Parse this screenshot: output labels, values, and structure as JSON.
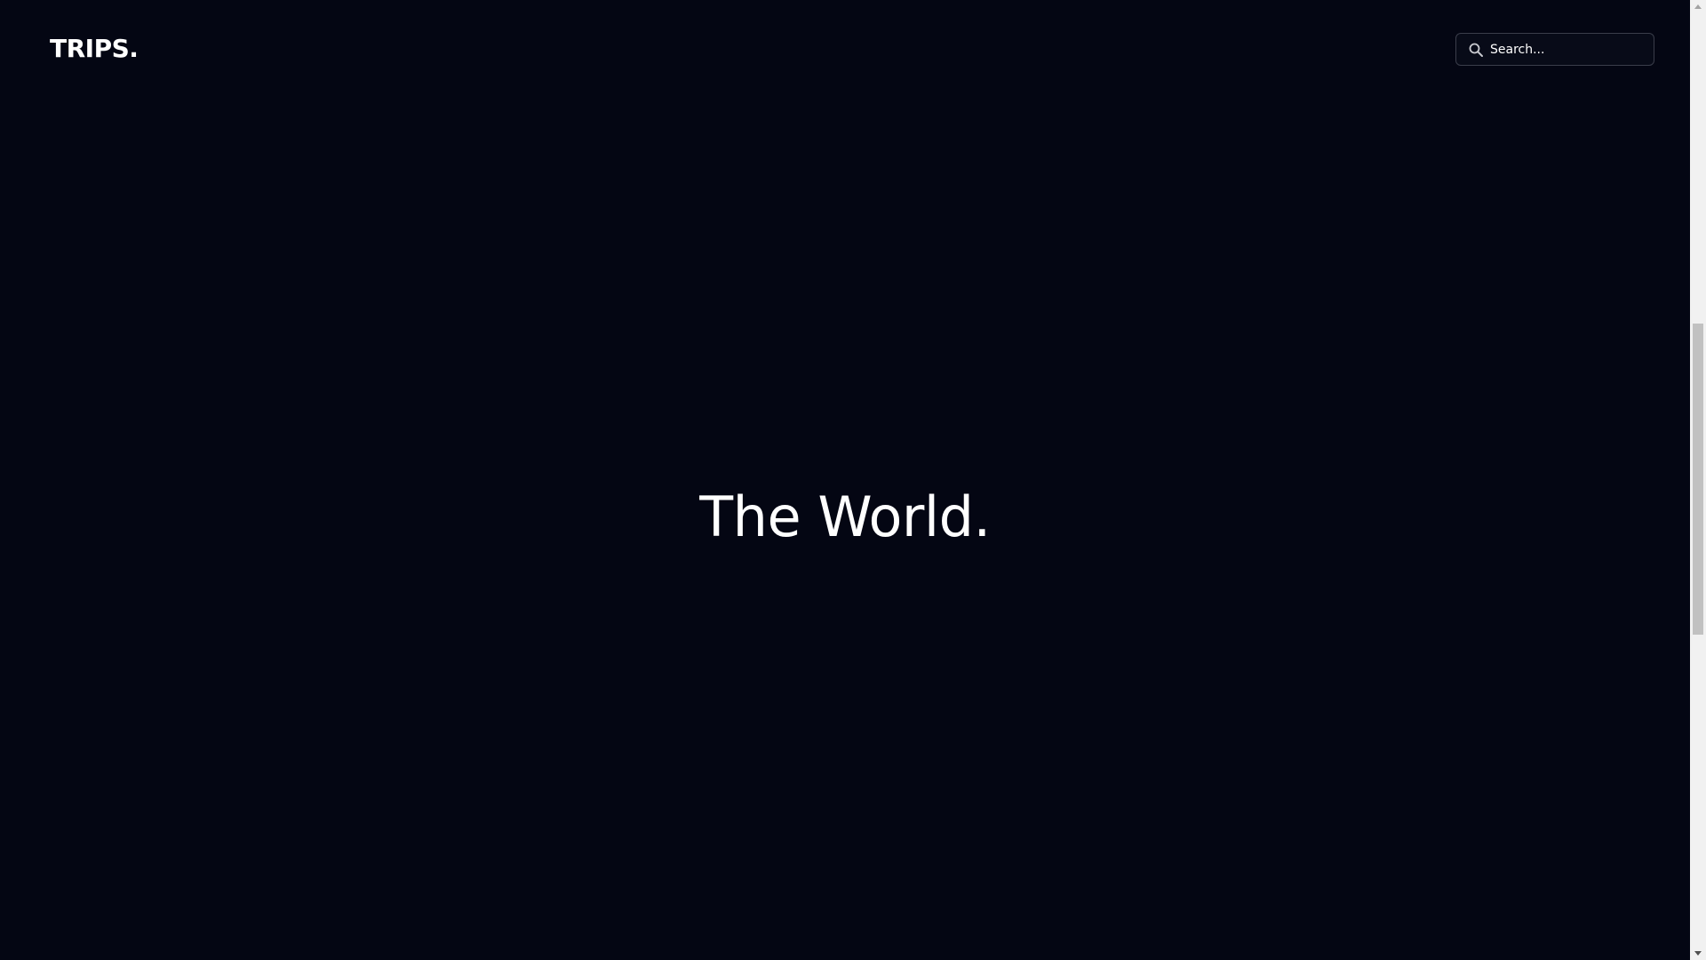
{
  "header": {
    "brand": "TRIPS.",
    "search": {
      "placeholder": "Search...",
      "value": "",
      "icon": "search-icon"
    }
  },
  "hero": {
    "title": "The World."
  },
  "colors": {
    "background": "#040613",
    "text": "#ffffff",
    "search_border": "#3a3d4a",
    "scrollbar_track": "#f1f1f1",
    "scrollbar_thumb": "#c1c1c1"
  },
  "scrollbar": {
    "position_fraction": 0.34
  }
}
